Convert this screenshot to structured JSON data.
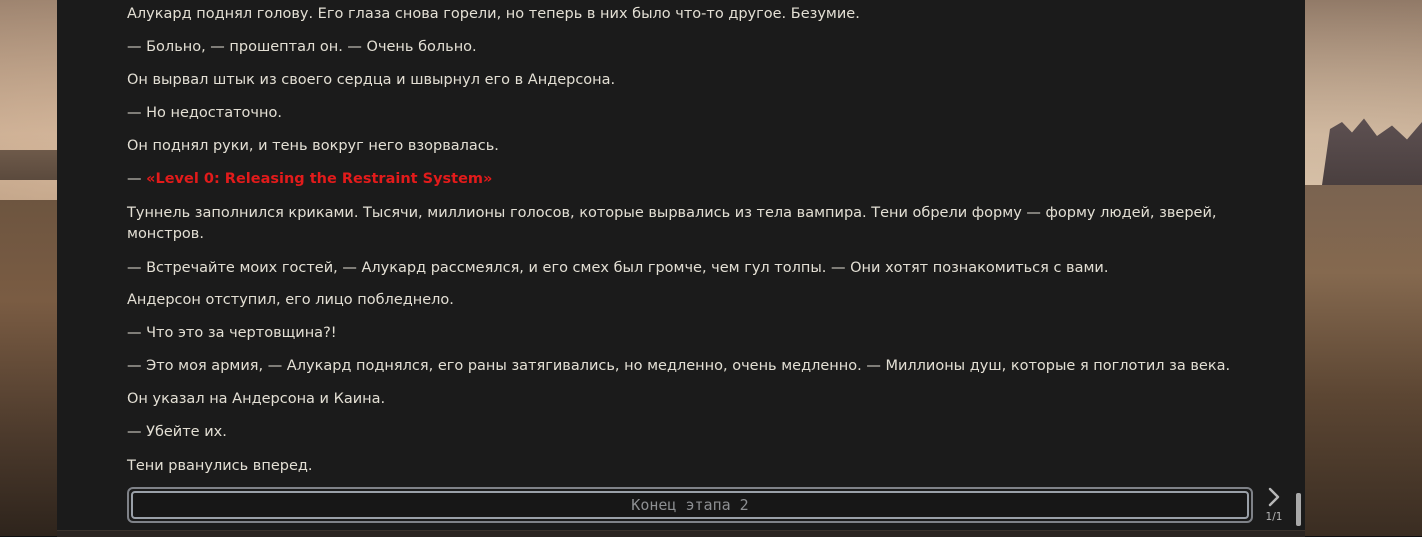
{
  "story": {
    "lines": [
      "Алукард поднял голову. Его глаза снова горели, но теперь в них было что-то другое. Безумие.",
      "— Больно, — прошептал он. — Очень больно.",
      "Он вырвал штык из своего сердца и швырнул его в Андерсона.",
      "— Но недостаточно.",
      "Он поднял руки, и тень вокруг него взорвалась.",
      "Туннель заполнился криками. Тысячи, миллионы голосов, которые вырвались из тела вампира. Тени обрели форму — форму людей, зверей, монстров.",
      "— Встречайте моих гостей, — Алукард рассмеялся, и его смех был громче, чем гул толпы. — Они хотят познакомиться с вами.",
      "Андерсон отступил, его лицо побледнело.",
      "— Что это за чертовщина?!",
      "— Это моя армия, — Алукард поднялся, его раны затягивались, но медленно, очень медленно. — Миллионы душ, которые я поглотил за века.",
      "Он указал на Андерсона и Каина.",
      "— Убейте их.",
      "Тени рванулись вперед."
    ],
    "special_prefix": "— ",
    "special_highlight": "«Level 0: Releasing the Restraint System»"
  },
  "input": {
    "placeholder": "Конец этапа 2"
  },
  "pager": {
    "label": "1/1"
  },
  "colors": {
    "panel": "#1b1b1b",
    "text": "#e3dfd4",
    "highlight": "#e21b1b"
  }
}
